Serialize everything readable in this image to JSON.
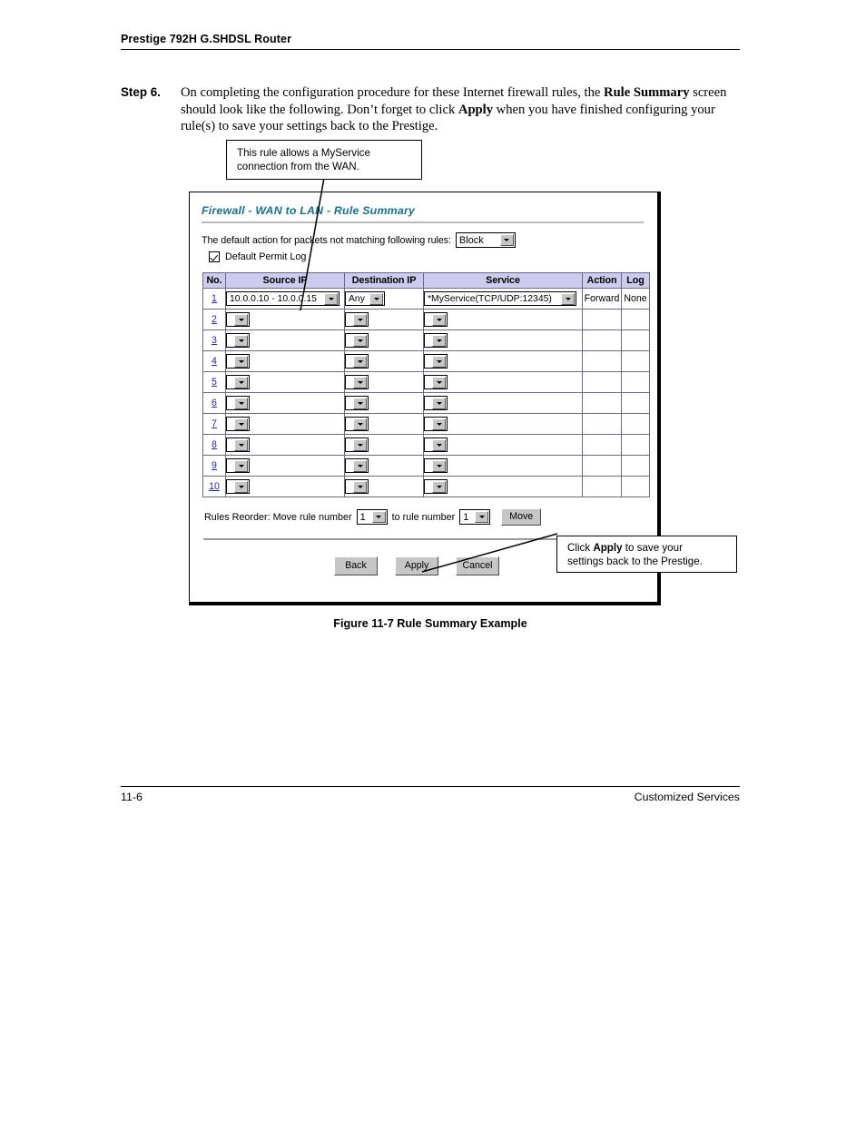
{
  "header": {
    "title": "Prestige 792H G.SHDSL Router"
  },
  "step": {
    "label": "Step 6.",
    "text_1": "On completing the configuration procedure for these Internet firewall rules, the ",
    "bold_1": "Rule Summary",
    "text_2": " screen should look like the following. Don’t forget to click ",
    "bold_2": "Apply",
    "text_3": " when you have finished configuring your rule(s) to save your settings back to the Prestige."
  },
  "callouts": {
    "rule": {
      "line_1": "This rule allows a MyService",
      "line_2": "connection from the WAN."
    },
    "apply": {
      "text_1": "Click ",
      "bold_1": "Apply",
      "text_2": " to save your",
      "line_2": "settings back to the Prestige."
    }
  },
  "screen": {
    "title": "Firewall - WAN to LAN - Rule Summary",
    "default_action_label": "The default action for packets not matching following rules:",
    "default_action_value": "Block",
    "default_permit_log_label": "Default Permit Log",
    "default_permit_log_checked": true,
    "table": {
      "headers": [
        "No.",
        "Source IP",
        "Destination IP",
        "Service",
        "Action",
        "Log"
      ],
      "rows": [
        {
          "no": "1",
          "source_ip": "10.0.0.10 - 10.0.0.15",
          "destination_ip": "Any",
          "service": "*MyService(TCP/UDP:12345)",
          "action": "Forward",
          "log": "None"
        },
        {
          "no": "2",
          "source_ip": "",
          "destination_ip": "",
          "service": "",
          "action": "",
          "log": ""
        },
        {
          "no": "3",
          "source_ip": "",
          "destination_ip": "",
          "service": "",
          "action": "",
          "log": ""
        },
        {
          "no": "4",
          "source_ip": "",
          "destination_ip": "",
          "service": "",
          "action": "",
          "log": ""
        },
        {
          "no": "5",
          "source_ip": "",
          "destination_ip": "",
          "service": "",
          "action": "",
          "log": ""
        },
        {
          "no": "6",
          "source_ip": "",
          "destination_ip": "",
          "service": "",
          "action": "",
          "log": ""
        },
        {
          "no": "7",
          "source_ip": "",
          "destination_ip": "",
          "service": "",
          "action": "",
          "log": ""
        },
        {
          "no": "8",
          "source_ip": "",
          "destination_ip": "",
          "service": "",
          "action": "",
          "log": ""
        },
        {
          "no": "9",
          "source_ip": "",
          "destination_ip": "",
          "service": "",
          "action": "",
          "log": ""
        },
        {
          "no": "10",
          "source_ip": "",
          "destination_ip": "",
          "service": "",
          "action": "",
          "log": ""
        }
      ]
    },
    "reorder": {
      "label_1": "Rules Reorder: Move rule number",
      "from_value": "1",
      "label_2": "to rule number",
      "to_value": "1",
      "move_button": "Move"
    },
    "buttons": {
      "back": "Back",
      "apply": "Apply",
      "cancel": "Cancel"
    }
  },
  "figure": {
    "caption": "Figure 11-7 Rule Summary Example"
  },
  "footer": {
    "page_number": "11-6",
    "section": "Customized Services"
  },
  "colors": {
    "screen_title": "#17708f",
    "table_header_bg": "#ccccee",
    "link": "#2222cc",
    "button_face": "#c6c6c6"
  }
}
